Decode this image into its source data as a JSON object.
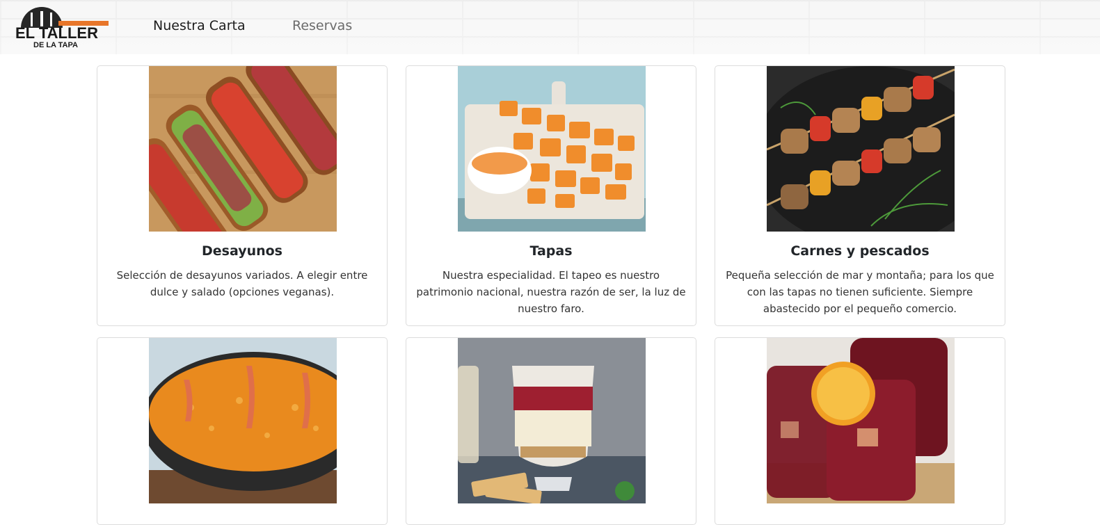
{
  "header": {
    "logo": {
      "line1": "EL TALLER",
      "line2": "DE LA TAPA",
      "accent_color": "#e8762a"
    },
    "nav": [
      {
        "label": "Nuestra Carta"
      },
      {
        "label": "Reservas"
      }
    ]
  },
  "cards": [
    {
      "title": "Desayunos",
      "text": "Selección de desayunos variados. A elegir entre dulce y salado (opciones veganas).",
      "image": "bruschetta-toasts-photo"
    },
    {
      "title": "Tapas",
      "text": "Nuestra especialidad. El tapeo es nuestro patrimonio nacional, nuestra razón de ser, la luz de nuestro faro.",
      "image": "patatas-bravas-photo"
    },
    {
      "title": "Carnes y pescados",
      "text": "Pequeña selección de mar y montaña; para los que con las tapas no tienen suficiente. Siempre abastecido por el pequeño comercio.",
      "image": "skewers-photo"
    },
    {
      "title": "",
      "text": "",
      "image": "paella-photo"
    },
    {
      "title": "",
      "text": "",
      "image": "dessert-glass-photo"
    },
    {
      "title": "",
      "text": "",
      "image": "sangria-photo"
    }
  ]
}
